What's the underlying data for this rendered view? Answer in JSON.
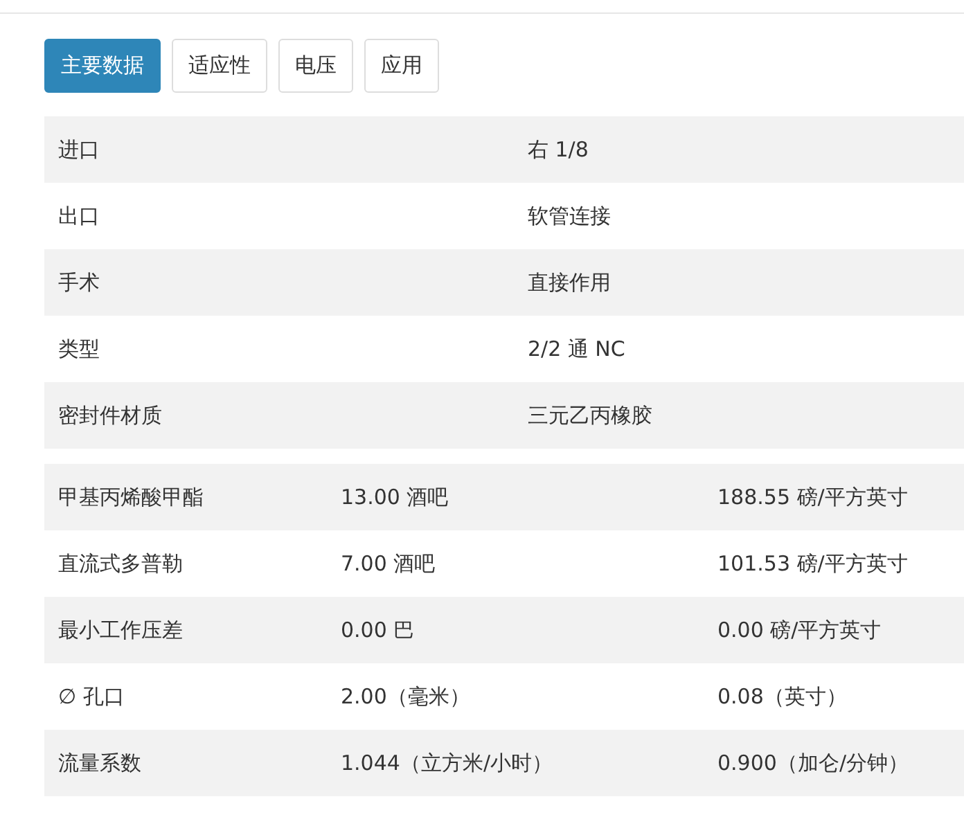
{
  "tabs": [
    {
      "label": "主要数据",
      "selected": true
    },
    {
      "label": "适应性",
      "selected": false
    },
    {
      "label": "电压",
      "selected": false
    },
    {
      "label": "应用",
      "selected": false
    }
  ],
  "main_table": {
    "rows": [
      {
        "label": "进口",
        "value": "右 1/8"
      },
      {
        "label": "出口",
        "value": "软管连接"
      },
      {
        "label": "手术",
        "value": "直接作用"
      },
      {
        "label": "类型",
        "value": "2/2 通 NC"
      },
      {
        "label": "密封件材质",
        "value": "三元乙丙橡胶"
      }
    ]
  },
  "pressure_table": {
    "rows": [
      {
        "label": "甲基丙烯酸甲酯",
        "metric": "13.00 酒吧",
        "imperial": "188.55 磅/平方英寸"
      },
      {
        "label": "直流式多普勒",
        "metric": "7.00 酒吧",
        "imperial": "101.53 磅/平方英寸"
      },
      {
        "label": "最小工作压差",
        "metric": "0.00 巴",
        "imperial": "0.00 磅/平方英寸"
      },
      {
        "label": "∅ 孔口",
        "metric": "2.00（毫米）",
        "imperial": "0.08（英寸）"
      },
      {
        "label": "流量系数",
        "metric": "1.044（立方米/小时）",
        "imperial": "0.900（加仑/分钟）"
      }
    ]
  }
}
